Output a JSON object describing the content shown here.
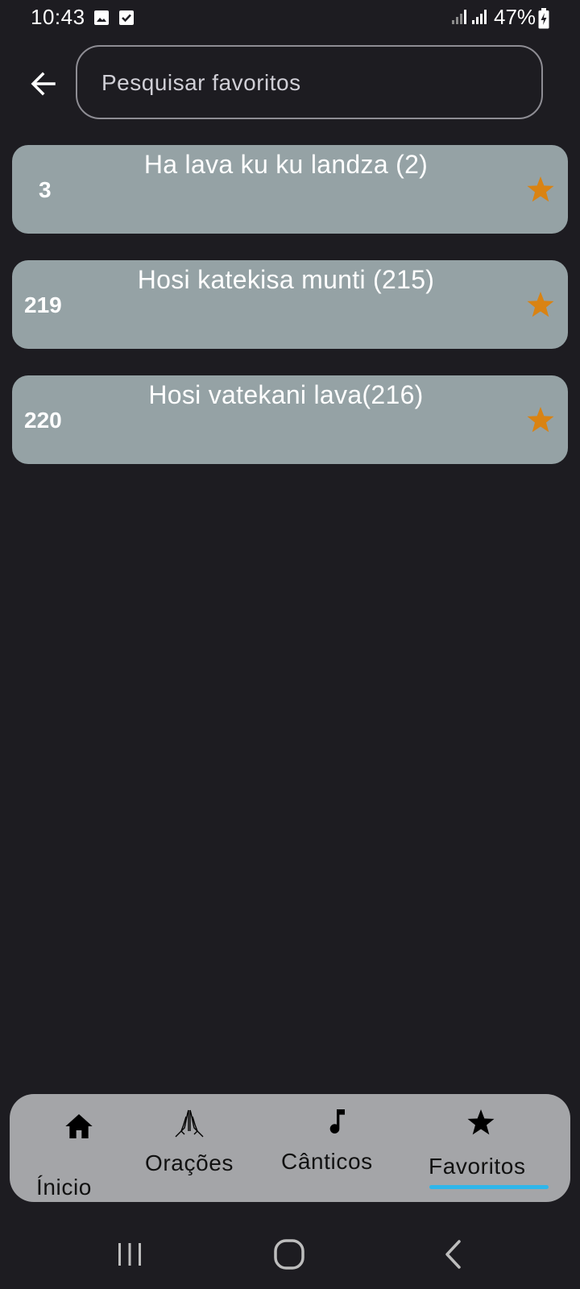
{
  "status_bar": {
    "time": "10:43",
    "battery": "47%"
  },
  "search": {
    "placeholder": "Pesquisar favoritos",
    "value": ""
  },
  "favorites": [
    {
      "number": "3",
      "title": "Ha lava ku ku landza (2)"
    },
    {
      "number": "219",
      "title": "Hosi katekisa munti (215)"
    },
    {
      "number": "220",
      "title": "Hosi vatekani lava(216)"
    }
  ],
  "bottom_nav": {
    "items": [
      {
        "label": "Ínicio",
        "icon": "home-icon"
      },
      {
        "label": "Orações",
        "icon": "praying-hands-icon"
      },
      {
        "label": "Cânticos",
        "icon": "music-note-icon"
      },
      {
        "label": "Favoritos",
        "icon": "star-icon"
      }
    ],
    "active_index": 3
  },
  "colors": {
    "background": "#1d1c21",
    "card": "#95a2a5",
    "star": "#d98313",
    "nav_background": "#a4a5a8",
    "nav_indicator": "#2fb6ea"
  }
}
